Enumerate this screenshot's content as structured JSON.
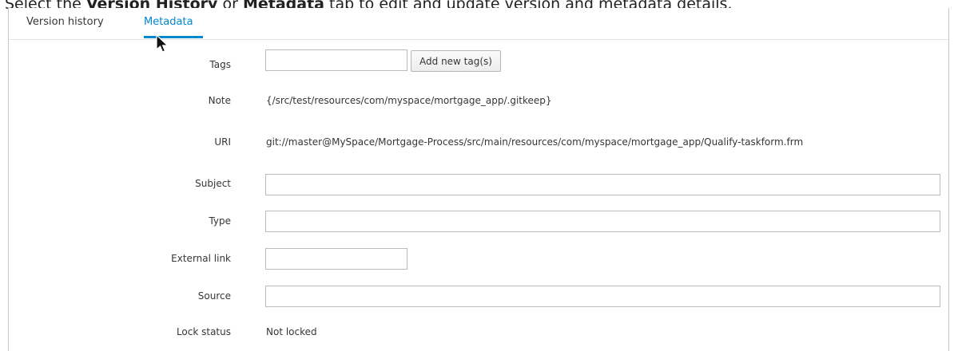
{
  "caption": {
    "prefix": "Select the ",
    "bold1": "Version History",
    "middle": " or ",
    "bold2": "Metadata",
    "suffix": " tab to edit and update version and metadata details."
  },
  "tabs": [
    {
      "label": "Version history",
      "active": false
    },
    {
      "label": "Metadata",
      "active": true
    }
  ],
  "metadata": {
    "tags": {
      "label": "Tags",
      "value": "",
      "button": "Add new tag(s)"
    },
    "note": {
      "label": "Note",
      "value": "{/src/test/resources/com/myspace/mortgage_app/.gitkeep}"
    },
    "uri": {
      "label": "URI",
      "value": "git://master@MySpace/Mortgage-Process/src/main/resources/com/myspace/mortgage_app/Qualify-taskform.frm"
    },
    "subject": {
      "label": "Subject",
      "value": ""
    },
    "type": {
      "label": "Type",
      "value": ""
    },
    "external_link": {
      "label": "External link",
      "value": ""
    },
    "source": {
      "label": "Source",
      "value": ""
    },
    "lock_status": {
      "label": "Lock status",
      "value": "Not locked"
    }
  },
  "colors": {
    "accent": "#0088ce",
    "text": "#363636",
    "border": "#bbbbbb"
  },
  "icons": {
    "cursor": "mouse-pointer-icon"
  }
}
